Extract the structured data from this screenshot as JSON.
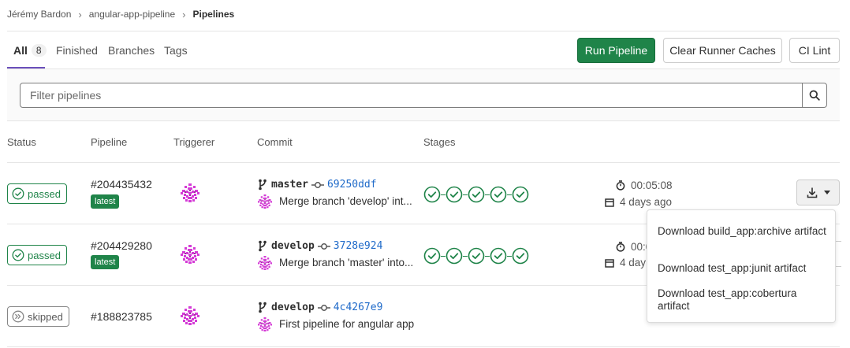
{
  "breadcrumb": {
    "user": "Jérémy Bardon",
    "project": "angular-app-pipeline",
    "current": "Pipelines",
    "separator": "›"
  },
  "tabs": {
    "all_label": "All",
    "all_count": "8",
    "finished": "Finished",
    "branches": "Branches",
    "tags": "Tags"
  },
  "actions": {
    "run_pipeline": "Run Pipeline",
    "clear_caches": "Clear Runner Caches",
    "ci_lint": "CI Lint"
  },
  "filter": {
    "placeholder": "Filter pipelines"
  },
  "table": {
    "headers": {
      "status": "Status",
      "pipeline": "Pipeline",
      "triggerer": "Triggerer",
      "commit": "Commit",
      "stages": "Stages"
    },
    "rows": [
      {
        "status": "passed",
        "id": "#204435432",
        "badge": "latest",
        "branch": "master",
        "sha": "69250ddf",
        "message": "Merge branch 'develop' int...",
        "duration": "00:05:08",
        "finished": "4 days ago"
      },
      {
        "status": "passed",
        "id": "#204429280",
        "badge": "latest",
        "branch": "develop",
        "sha": "3728e924",
        "message": "Merge branch 'master' into...",
        "duration": "00:0",
        "finished": "4 day"
      },
      {
        "status": "skipped",
        "id": "#188823785",
        "badge": "",
        "branch": "develop",
        "sha": "4c4267e9",
        "message": "First pipeline for angular app"
      }
    ]
  },
  "artifacts_dropdown": {
    "items": [
      "Download build_app:archive artifact",
      "Download test_app:junit artifact",
      "Download test_app:cobertura artifact"
    ]
  },
  "colors": {
    "success": "#1f8449",
    "link": "#1f6ac9",
    "tab_underline": "#6b4fbb",
    "skipped": "#868686"
  },
  "icons": {
    "status_passed": "check-circle-icon",
    "status_skipped": "skipped-icon",
    "branch": "branch-icon",
    "commit": "commit-icon",
    "duration": "timer-icon",
    "date": "calendar-icon",
    "search": "search-icon",
    "download": "download-icon",
    "caret": "chevron-down-icon"
  }
}
